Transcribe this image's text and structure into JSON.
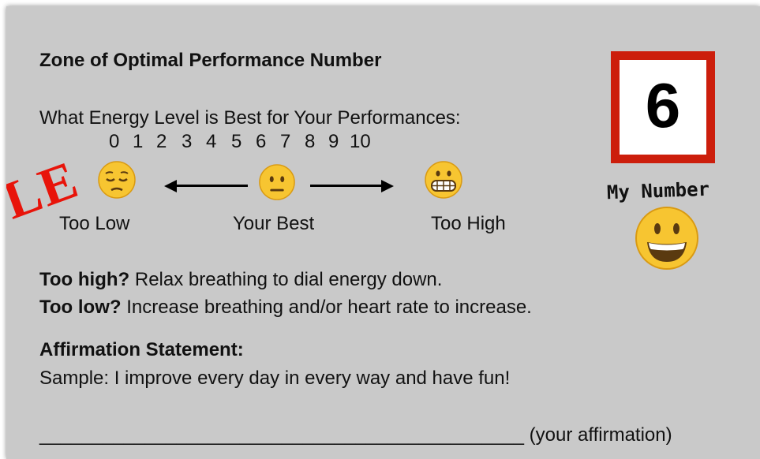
{
  "title": "Zone of Optimal Performance Number",
  "question": "What Energy Level is Best for Your Performances:",
  "scale": [
    "0",
    "1",
    "2",
    "3",
    "4",
    "5",
    "6",
    "7",
    "8",
    "9",
    "10"
  ],
  "zones": {
    "low": "Too Low",
    "best": "Your Best",
    "high": "Too High"
  },
  "my_number": {
    "value": "6",
    "caption": "My Number"
  },
  "tips": {
    "high_bold": "Too high?",
    "high_text": " Relax breathing to dial energy down.",
    "low_bold": "Too low?",
    "low_text": " Increase breathing and/or heart rate to increase."
  },
  "affirmation": {
    "heading": "Affirmation Statement:",
    "sample": "Sample: I improve every day in every way and have fun!",
    "blank": "______________________________________________",
    "blank_caption": " (your affirmation)"
  },
  "watermark": "LE",
  "colors": {
    "card": "#c9c9c9",
    "box_border": "#cc1e0c",
    "watermark": "#e8140a",
    "emoji_face": "#f7c531"
  }
}
